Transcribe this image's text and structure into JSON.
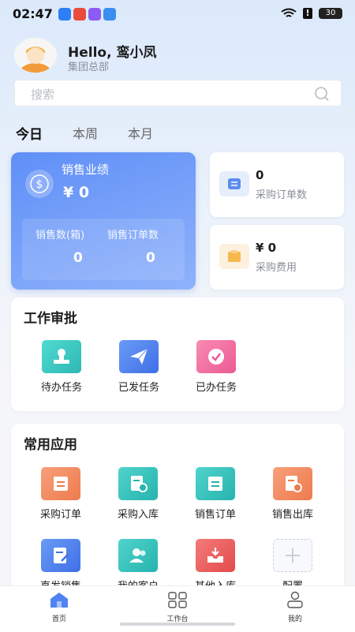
{
  "status_bar": {
    "time": "02:47",
    "battery": "30",
    "alert": "!"
  },
  "user": {
    "greeting": "Hello, 鸾小凤",
    "department": "集团总部"
  },
  "search": {
    "placeholder": "搜索"
  },
  "period_tabs": {
    "items": [
      "今日",
      "本周",
      "本月"
    ],
    "active": "今日"
  },
  "sales": {
    "title": "销售业绩",
    "amount": "¥ 0",
    "qty_label": "销售数(箱)",
    "qty_value": "0",
    "orders_label": "销售订单数",
    "orders_value": "0"
  },
  "purchase_orders": {
    "value": "0",
    "label": "采购订单数"
  },
  "purchase_cost": {
    "value": "¥ 0",
    "label": "采购费用"
  },
  "approval": {
    "title": "工作审批",
    "items": [
      {
        "label": "待办任务",
        "icon": "stamp-icon",
        "color": "#3fcfc6"
      },
      {
        "label": "已发任务",
        "icon": "paper-plane-icon",
        "color": "#4f83f1"
      },
      {
        "label": "已办任务",
        "icon": "check-circle-icon",
        "color": "#f46fa0"
      }
    ]
  },
  "apps": {
    "title": "常用应用",
    "items": [
      {
        "label": "采购订单",
        "icon": "purchase-order-icon",
        "color": "#f2895e"
      },
      {
        "label": "采购入库",
        "icon": "purchase-inbound-icon",
        "color": "#34c2bd"
      },
      {
        "label": "销售订单",
        "icon": "sales-order-icon",
        "color": "#34c2bd"
      },
      {
        "label": "销售出库",
        "icon": "sales-outbound-icon",
        "color": "#f2895e"
      },
      {
        "label": "直发销售",
        "icon": "direct-sales-icon",
        "color": "#4f7ff0"
      },
      {
        "label": "我的客户",
        "icon": "customers-icon",
        "color": "#34c2bd"
      },
      {
        "label": "其他入库",
        "icon": "other-inbound-icon",
        "color": "#ee5c5c"
      },
      {
        "label": "配置",
        "icon": "plus-icon",
        "color": "#c9cfd8"
      }
    ]
  },
  "bottom_nav": [
    {
      "label": "首页",
      "icon": "home-icon",
      "active": true
    },
    {
      "label": "工作台",
      "icon": "workbench-icon",
      "active": false
    },
    {
      "label": "我的",
      "icon": "profile-icon",
      "active": false
    }
  ]
}
